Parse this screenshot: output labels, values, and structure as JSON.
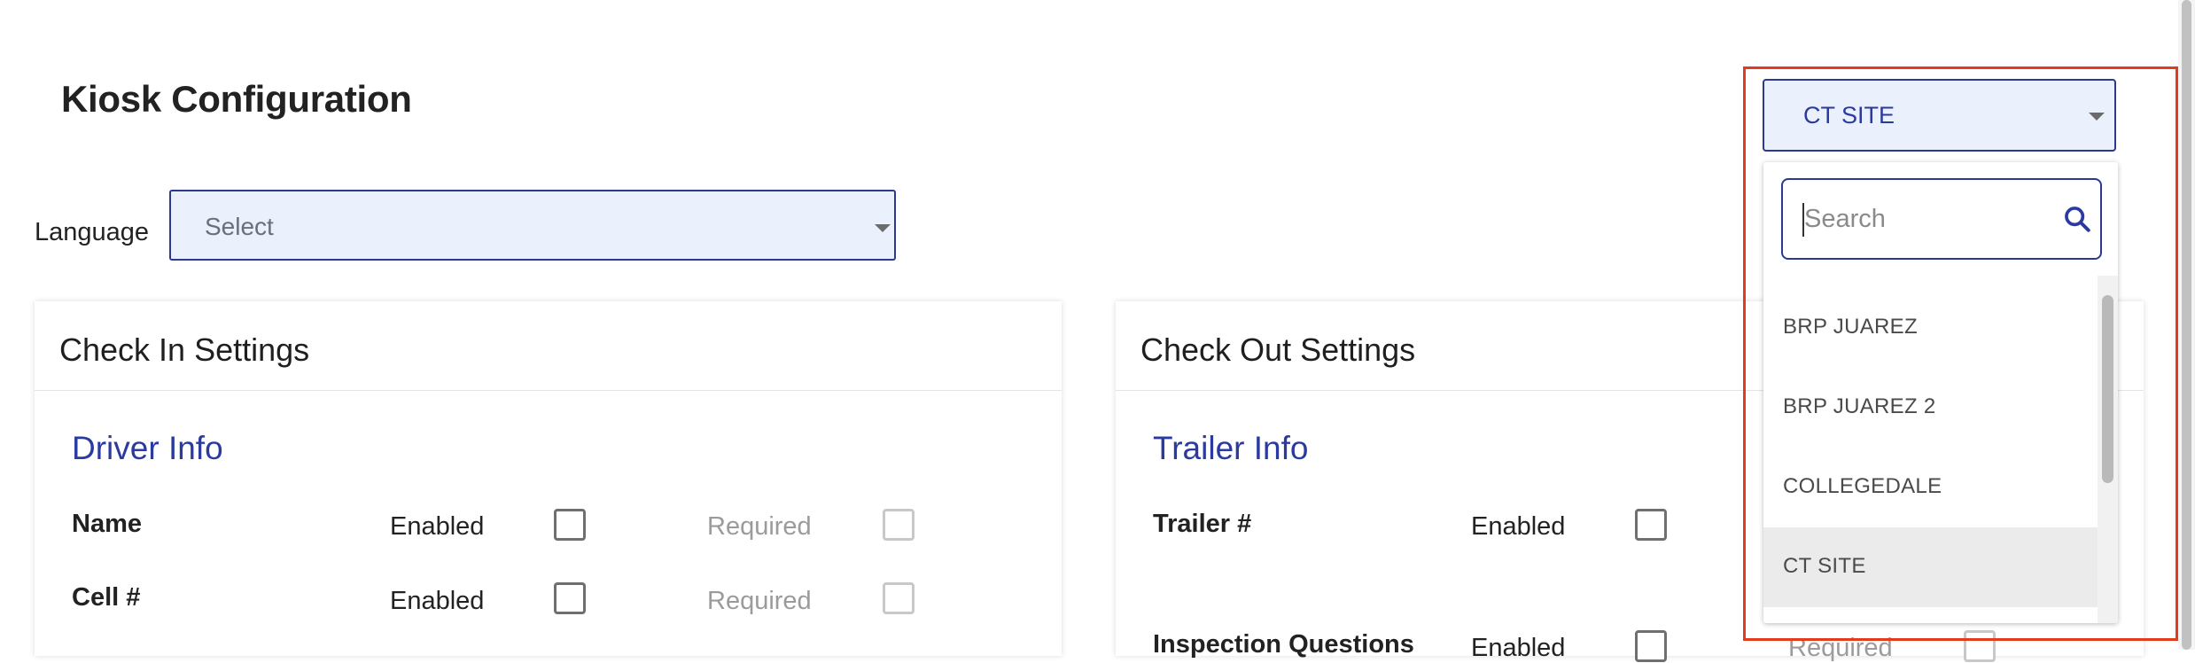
{
  "page": {
    "title": "Kiosk Configuration"
  },
  "language": {
    "label": "Language",
    "placeholder": "Select"
  },
  "site_selector": {
    "selected": "CT SITE",
    "search_placeholder": "Search",
    "options": [
      "BRP JUAREZ",
      "BRP JUAREZ 2",
      "COLLEGEDALE",
      "CT SITE"
    ]
  },
  "check_in": {
    "title": "Check In Settings",
    "section": "Driver Info",
    "rows": [
      {
        "label": "Name",
        "enabled": "Enabled",
        "required": "Required"
      },
      {
        "label": "Cell #",
        "enabled": "Enabled",
        "required": "Required"
      }
    ]
  },
  "check_out": {
    "title": "Check Out Settings",
    "section": "Trailer Info",
    "rows": [
      {
        "label": "Trailer #",
        "enabled": "Enabled"
      },
      {
        "label": "Inspection Questions",
        "enabled": "Enabled",
        "required": "Required"
      }
    ]
  },
  "colors": {
    "accent": "#2b3aa0",
    "highlight": "#e33b1d",
    "select_bg": "#eaf0fc"
  }
}
